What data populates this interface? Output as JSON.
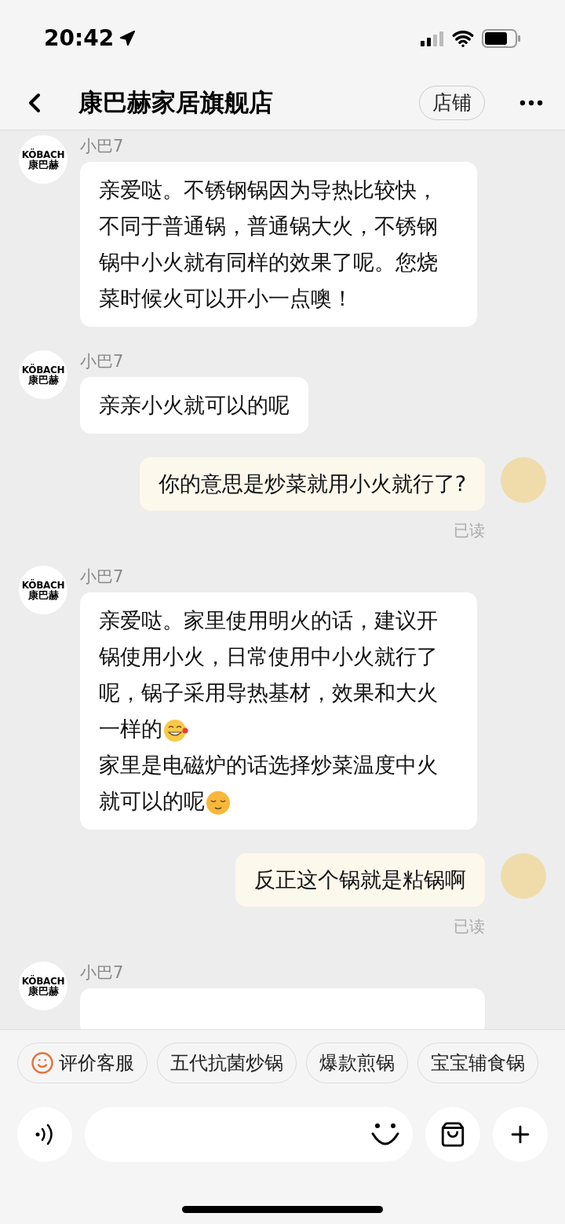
{
  "status_bar": {
    "time": "20:42"
  },
  "header": {
    "title": "康巴赫家居旗舰店",
    "shop_button": "店铺"
  },
  "messages": [
    {
      "kind": "incoming",
      "sender": "小巴7",
      "logo_top": "KÖBACH",
      "logo_bottom": "康巴赫",
      "paragraphs": [
        {
          "text": "亲爱哒。不锈钢锅因为导热比较快，不同于普通锅，普通锅大火，不锈钢锅中小火就有同样的效果了呢。您烧菜时候火可以开小一点噢！"
        }
      ]
    },
    {
      "kind": "incoming",
      "sender": "小巴7",
      "logo_top": "KÖBACH",
      "logo_bottom": "康巴赫",
      "paragraphs": [
        {
          "text": "亲亲小火就可以的呢"
        }
      ]
    },
    {
      "kind": "outgoing",
      "paragraphs": [
        {
          "text": "你的意思是炒菜就用小火就行了?"
        }
      ],
      "receipt": "已读"
    },
    {
      "kind": "incoming",
      "sender": "小巴7",
      "logo_top": "KÖBACH",
      "logo_bottom": "康巴赫",
      "paragraphs": [
        {
          "text": "亲爱哒。家里使用明火的话，建议开锅使用小火，日常使用中小火就行了呢，锅子采用导热基材，效果和大火一样的",
          "kind": "ends-grin-emoji"
        },
        {
          "text": "家里是电磁炉的话选择炒菜温度中火就可以的呢",
          "kind": "ends-smile-emoji"
        }
      ]
    },
    {
      "kind": "outgoing",
      "paragraphs": [
        {
          "text": "反正这个锅就是粘锅啊"
        }
      ],
      "receipt": "已读"
    },
    {
      "kind": "incoming",
      "sender": "小巴7",
      "logo_top": "KÖBACH",
      "logo_bottom": "康巴赫"
    }
  ],
  "quick_replies": [
    {
      "label": "评价客服",
      "kind": "rating"
    },
    {
      "label": "五代抗菌炒锅"
    },
    {
      "label": "爆款煎锅"
    },
    {
      "label": "宝宝辅食锅"
    }
  ]
}
